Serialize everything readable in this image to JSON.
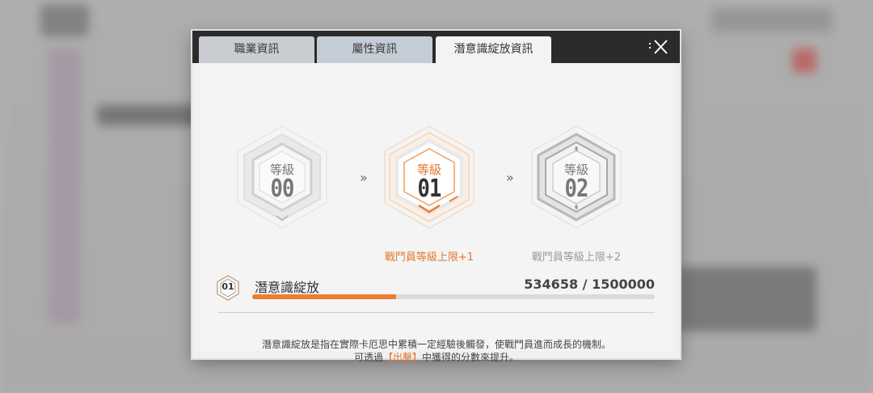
{
  "tabs": [
    {
      "label": "職業資訊"
    },
    {
      "label": "屬性資訊"
    },
    {
      "label": "潛意識綻放資訊"
    }
  ],
  "levels": [
    {
      "label": "等級",
      "value": "00",
      "reward": ""
    },
    {
      "label": "等級",
      "value": "01",
      "reward": "戰鬥員等級上限+1"
    },
    {
      "label": "等級",
      "value": "02",
      "reward": "戰鬥員等級上限+2"
    }
  ],
  "progress": {
    "badge": "01",
    "title": "潛意識綻放",
    "value_text": "534658 / 1500000",
    "current": 534658,
    "max": 1500000
  },
  "description": {
    "line1": "潛意識綻放是指在實際卡厄思中累積一定經驗後觸發，使戰鬥員進而成長的機制。",
    "line2_prefix": "可透過",
    "line2_highlight": "【出擊】",
    "line2_suffix": "中獲得的分數來提升。"
  },
  "colors": {
    "accent": "#ee7d2f",
    "active_text": "#e6772c"
  },
  "icons": {
    "close": "close-icon",
    "arrow": "double-chevron-right-icon"
  }
}
